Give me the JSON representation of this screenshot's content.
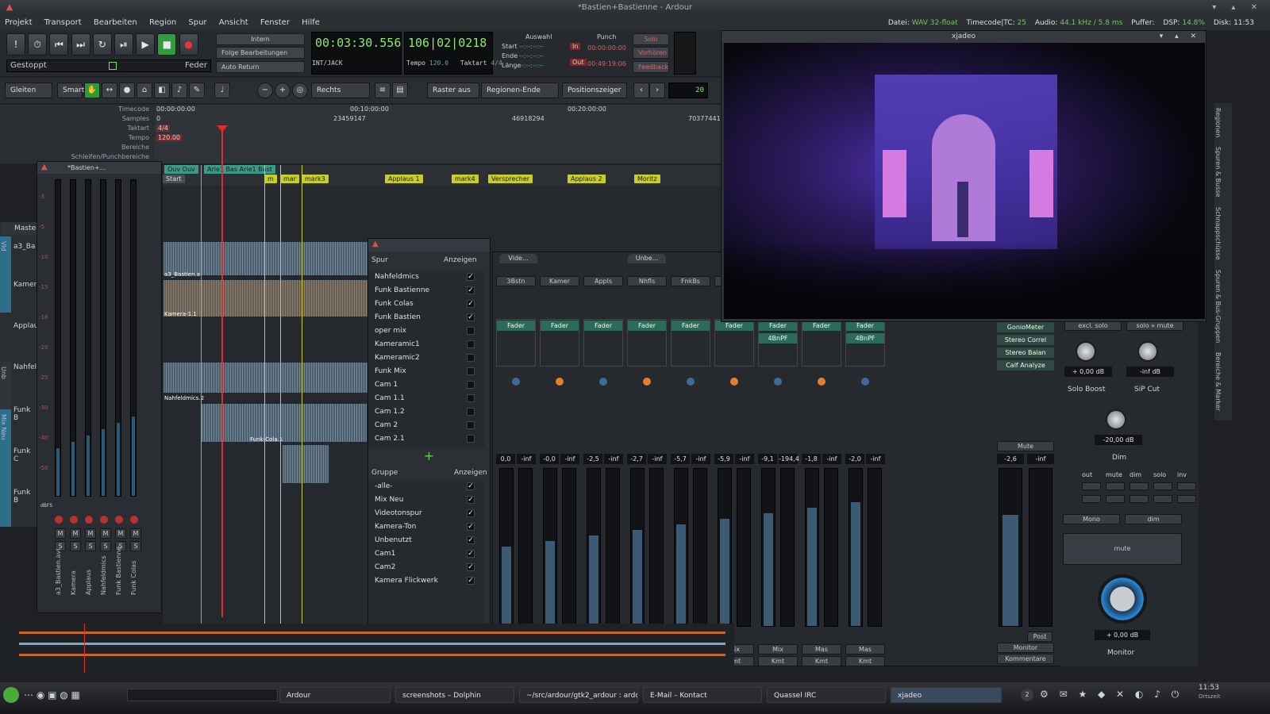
{
  "window": {
    "title": "*Bastien+Bastienne - Ardour"
  },
  "menu": [
    "Projekt",
    "Transport",
    "Bearbeiten",
    "Region",
    "Spur",
    "Ansicht",
    "Fenster",
    "Hilfe"
  ],
  "status": {
    "datei_label": "Datei:",
    "datei_value": "WAV 32-float",
    "timecode_label": "Timecode|TC:",
    "timecode_value": "25",
    "audio_label": "Audio:",
    "audio_value": "44.1 kHz / 5.8 ms",
    "puffer_label": "Puffer:",
    "puffer_value": "",
    "dsp_label": "DSP:",
    "dsp_value": "14.8%",
    "disk_label": "Disk:",
    "disk_value": "11:53"
  },
  "transport": {
    "gestoppt": "Gestoppt",
    "feder": "Feder",
    "intern": "Intern",
    "folge": "Folge Bearbeitungen",
    "auto_return": "Auto Return",
    "int_jack": "INT/JACK",
    "clock_time": "00:03:30.556",
    "clock_bbt": "106|02|0218",
    "tempo_label": "Tempo",
    "tempo_value": "120.0",
    "taktart_label": "Taktart",
    "taktart_value": "4/4",
    "auswahl": "Auswahl",
    "punch": "Punch",
    "start": "Start",
    "ende": "Ende",
    "laenge": "Länge",
    "sel_start": "--:--:--:--",
    "sel_end": "--:--:--:--",
    "sel_len": "--:--:--:--",
    "in": "In",
    "out": "Out",
    "punch_in": "00:00:00:00",
    "punch_out": "00:49:19:06",
    "solo": "Solo",
    "vorhoeren": "Vorhören",
    "feedback": "Feedback"
  },
  "editbar": {
    "gleiten": "Gleiten",
    "smart": "Smart",
    "rechts": "Rechts",
    "raster": "Raster aus",
    "regionen_ende": "Regionen-Ende",
    "positionszeiger": "Positionszeiger",
    "nudge": "20"
  },
  "rulers": {
    "labels": [
      "Timecode",
      "Samples",
      "Taktart",
      "Tempo",
      "Bereiche",
      "Schleifen/Punchbereiche"
    ],
    "timecode_ticks": [
      "00:00:00:00",
      "00:10:00:00",
      "00:20:00:00"
    ],
    "sample_ticks": [
      "0",
      "23459147",
      "46918294",
      "70377441"
    ],
    "taktart": "4/4",
    "tempo": "120.00"
  },
  "markers": {
    "ranges": [
      "Ouv Ouv",
      "Arie1 Bas Arie1 Bast"
    ],
    "items": [
      "Start",
      "m",
      "mar",
      "mark3",
      "Applaus 1",
      "mark4",
      "Versprecher",
      "Applaus 2",
      "Moritz"
    ]
  },
  "tracks": {
    "names": [
      "Master",
      "a3_Ba",
      "Kamera",
      "Applau",
      "Nahfel",
      "Funk B",
      "Funk C",
      "Funk B"
    ],
    "groups": [
      "Vid",
      "Unb",
      "Mix Neu"
    ],
    "region_labels": [
      "a3_Bastien.a",
      "Kamera-1.1",
      "Nahfeldmics.2",
      "Funk-Cola.1"
    ]
  },
  "meterwin": {
    "title": "*Bastien+...",
    "scale": [
      "-3",
      "-5",
      "-10",
      "-15",
      "-18",
      "-20",
      "-25",
      "-30",
      "-40",
      "-50"
    ],
    "dbfs": "dBFS",
    "channels": [
      "a3_Bastien.avi",
      "Kamera",
      "Applaus",
      "Nahfeldmics",
      "Funk Bastienne",
      "Funk Colas"
    ],
    "m": "M",
    "s": "S"
  },
  "spurpanel": {
    "col1": "Spur",
    "col2": "Anzeigen",
    "spuren": [
      {
        "name": "Nahfeldmics",
        "on": true
      },
      {
        "name": "Funk Bastienne",
        "on": true
      },
      {
        "name": "Funk Colas",
        "on": true
      },
      {
        "name": "Funk Bastien",
        "on": true
      },
      {
        "name": "oper mix",
        "on": false
      },
      {
        "name": "Kameramic1",
        "on": false
      },
      {
        "name": "Kameramic2",
        "on": false
      },
      {
        "name": "Funk Mix",
        "on": false
      },
      {
        "name": "Cam 1",
        "on": false
      },
      {
        "name": "Cam 1.1",
        "on": false
      },
      {
        "name": "Cam 1.2",
        "on": false
      },
      {
        "name": "Cam 2",
        "on": false
      },
      {
        "name": "Cam 2.1",
        "on": false
      }
    ],
    "gruppe_col1": "Gruppe",
    "gruppe_col2": "Anzeigen",
    "gruppen": [
      {
        "name": "-alle-",
        "on": true
      },
      {
        "name": "Mix Neu",
        "on": true
      },
      {
        "name": "Videotonspur",
        "on": true
      },
      {
        "name": "Kamera-Ton",
        "on": true
      },
      {
        "name": "Unbenutzt",
        "on": true
      },
      {
        "name": "Cam1",
        "on": true
      },
      {
        "name": "Cam2",
        "on": true
      },
      {
        "name": "Kamera Flickwerk",
        "on": true
      }
    ],
    "add": "+",
    "remove": "✕"
  },
  "mixer": {
    "group_tabs": [
      "Vide...",
      "Unbe..."
    ],
    "strips": [
      {
        "name": "3Bstn",
        "gain": "0,0",
        "peak": "-inf",
        "fader": "Fader",
        "plugin": ""
      },
      {
        "name": "Kamer",
        "gain": "-0,0",
        "peak": "-inf",
        "fader": "Fader",
        "plugin": ""
      },
      {
        "name": "Appls",
        "gain": "-2,5",
        "peak": "-inf",
        "fader": "Fader",
        "plugin": ""
      },
      {
        "name": "Nhfls",
        "gain": "-2,7",
        "peak": "-inf",
        "fader": "Fader",
        "plugin": ""
      },
      {
        "name": "FnkBs",
        "gain": "-5,7",
        "peak": "-inf",
        "fader": "Fader",
        "plugin": ""
      },
      {
        "name": "",
        "gain": "-5,9",
        "peak": "-inf",
        "fader": "Fader",
        "plugin": ""
      },
      {
        "name": "",
        "gain": "-9,1",
        "peak": "-194,4",
        "fader": "Fader",
        "plugin": "4BnPF"
      },
      {
        "name": "",
        "gain": "-1,8",
        "peak": "-inf",
        "fader": "Fader",
        "plugin": ""
      },
      {
        "name": "",
        "gain": "-2,0",
        "peak": "-inf",
        "fader": "Fader",
        "plugin": "4BnPF"
      }
    ],
    "bottom_labels": [
      "Mas",
      "Mix",
      "Kmt"
    ],
    "master": {
      "plugins": [
        "GonioMeter",
        "Stereo Correl",
        "Stereo Balan",
        "Calf Analyze"
      ],
      "mute": "Mute",
      "gain": "-2,6",
      "peak": "-inf",
      "monitor": "Monitor",
      "kommentare": "Kommentare",
      "post": "Post"
    }
  },
  "monitor": {
    "excl_solo": "excl. solo",
    "solo_mute": "solo » mute",
    "solo_boost_val": "+ 0,00 dB",
    "sip_cut_val": "-inf dB",
    "solo_boost": "Solo Boost",
    "sip_cut": "SiP Cut",
    "dim_val": "-20,00 dB",
    "dim": "Dim",
    "cols": [
      "out",
      "mute",
      "dim",
      "solo",
      "inv"
    ],
    "mono": "Mono",
    "dim_btn": "dim",
    "mute": "mute",
    "out_val": "+ 0,00 dB",
    "title": "Monitor"
  },
  "video": {
    "title": "xjadeo"
  },
  "rightstrip": [
    "Regionen",
    "Spuren & Busse",
    "Schnappschüsse",
    "Spuren & Bus-Gruppen",
    "Bereiche & Marker"
  ],
  "taskbar": {
    "items": [
      "Ardour",
      "screenshots – Dolphin",
      "~/src/ardour/gtk2_ardour : ardo",
      "E-Mail – Kontact",
      "Quassel IRC",
      "xjadeo"
    ],
    "clock": "11:53",
    "place": "Ortszeit",
    "workspace": "2"
  },
  "colors": {
    "accent": "#8ee86f",
    "playhead": "#e02b2b",
    "marker": "#c9cc2e",
    "fader": "#2c6a5a"
  }
}
